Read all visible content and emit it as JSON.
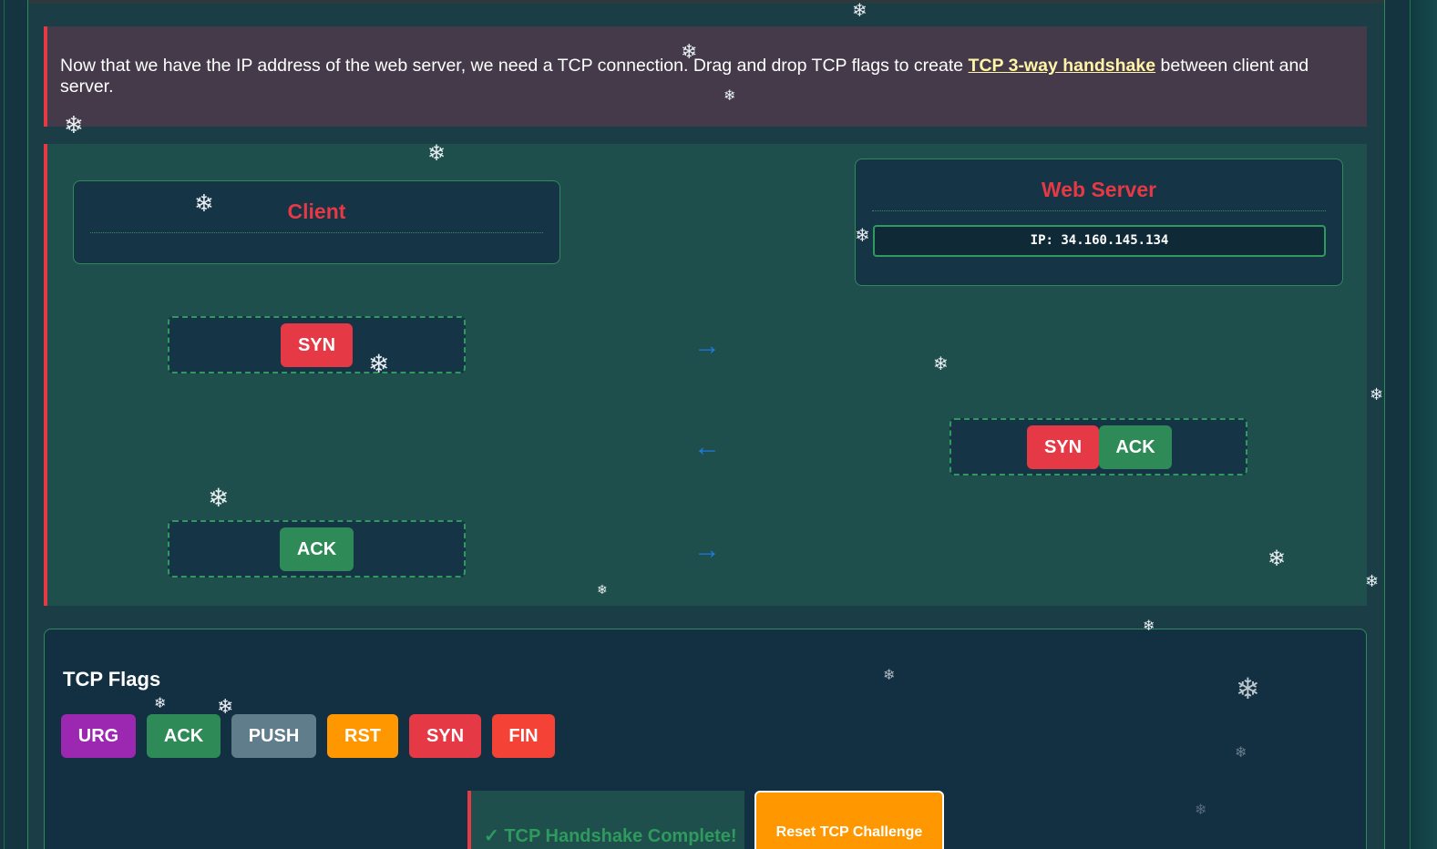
{
  "instruction": {
    "text_before": "Now that we have the IP address of the web server, we need a TCP connection. Drag and drop TCP flags to create ",
    "link": "TCP 3-way handshake",
    "text_after": " between client and server."
  },
  "client": {
    "title": "Client"
  },
  "server": {
    "title": "Web Server",
    "ip": "IP: 34.160.145.134"
  },
  "handshake": {
    "step1": {
      "flags": [
        "SYN"
      ],
      "direction": "→"
    },
    "step2": {
      "flags": [
        "SYN",
        "ACK"
      ],
      "direction": "←"
    },
    "step3": {
      "flags": [
        "ACK"
      ],
      "direction": "→"
    }
  },
  "flags_panel": {
    "title": "TCP Flags",
    "flags": [
      {
        "label": "URG",
        "color": "#9c27b0"
      },
      {
        "label": "ACK",
        "color": "#2e8b57"
      },
      {
        "label": "PUSH",
        "color": "#607d8b"
      },
      {
        "label": "RST",
        "color": "#ff9800"
      },
      {
        "label": "SYN",
        "color": "#e53945"
      },
      {
        "label": "FIN",
        "color": "#f44336"
      }
    ],
    "status": "✓ TCP Handshake Complete!",
    "reset_label": "Reset TCP Challenge"
  },
  "colors": {
    "accent_red": "#e53945",
    "success_green": "#2e8b57",
    "arrow_blue": "#1e7ae0",
    "reset_orange": "#ff9800"
  },
  "decorations": {
    "snowflake_icon": "❄"
  }
}
